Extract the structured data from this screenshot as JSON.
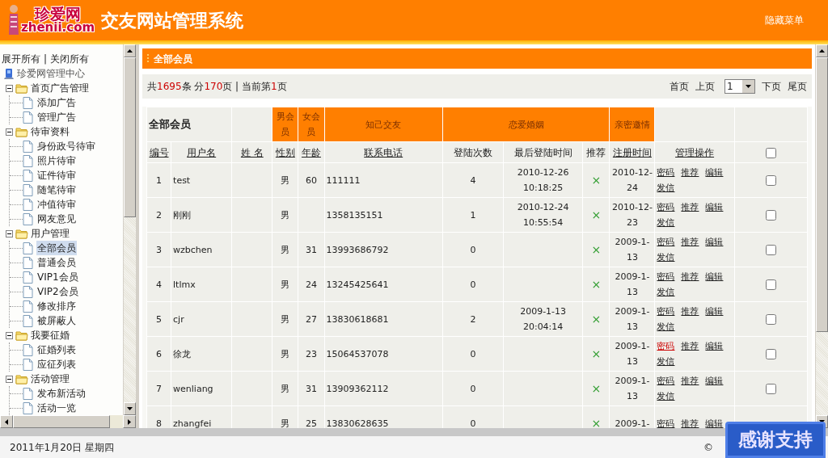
{
  "header": {
    "logo_text": "珍爱网",
    "logo_domain": "zhenii.com",
    "title": "交友网站管理系统",
    "hide_menu": "隐藏菜单"
  },
  "sidebar": {
    "expand_all": "展开所有",
    "separator": "|",
    "collapse_all": "关闭所有",
    "root": "珍爱网管理中心",
    "groups": [
      {
        "label": "首页广告管理",
        "expanded": true,
        "children": [
          {
            "label": "添加广告",
            "selected": false
          },
          {
            "label": "管理广告",
            "selected": false
          }
        ]
      },
      {
        "label": "待审资料",
        "expanded": true,
        "children": [
          {
            "label": "身份政号待审",
            "selected": false
          },
          {
            "label": "照片待审",
            "selected": false
          },
          {
            "label": "证件待审",
            "selected": false
          },
          {
            "label": "随笔待审",
            "selected": false
          },
          {
            "label": "冲值待审",
            "selected": false
          },
          {
            "label": "网友意见",
            "selected": false
          }
        ]
      },
      {
        "label": "用户管理",
        "expanded": true,
        "children": [
          {
            "label": "全部会员",
            "selected": true
          },
          {
            "label": "普通会员",
            "selected": false
          },
          {
            "label": "VIP1会员",
            "selected": false
          },
          {
            "label": "VIP2会员",
            "selected": false
          },
          {
            "label": "修改排序",
            "selected": false
          },
          {
            "label": "被屏蔽人",
            "selected": false
          }
        ]
      },
      {
        "label": "我要征婚",
        "expanded": true,
        "children": [
          {
            "label": "征婚列表",
            "selected": false
          },
          {
            "label": "应征列表",
            "selected": false
          }
        ]
      },
      {
        "label": "活动管理",
        "expanded": true,
        "children": [
          {
            "label": "发布新活动",
            "selected": false
          },
          {
            "label": "活动一览",
            "selected": false
          }
        ]
      }
    ]
  },
  "panel_title": "全部会员",
  "summary": [
    {
      "text": "共",
      "emphasis": false
    },
    {
      "text": "1695",
      "emphasis": true
    },
    {
      "text": "条 分",
      "emphasis": false
    },
    {
      "text": "170",
      "emphasis": true
    },
    {
      "text": "页 | 当前第",
      "emphasis": false
    },
    {
      "text": "1",
      "emphasis": true
    },
    {
      "text": "页",
      "emphasis": false
    }
  ],
  "pager": {
    "first": "首页",
    "prev": "上页",
    "page": "1",
    "next": "下页",
    "last": "尾页"
  },
  "table": {
    "caption": "全部会员",
    "groups": [
      {
        "label": "男会员",
        "kind": "orange"
      },
      {
        "label": "女会员",
        "kind": "orange"
      },
      {
        "label": "知己交友",
        "kind": "orange"
      },
      {
        "label": "恋爱婚姻",
        "kind": "orange"
      },
      {
        "label": "亲密邀情",
        "kind": "orange"
      }
    ],
    "columns": [
      {
        "label": "编号",
        "link": true
      },
      {
        "label": "用户名",
        "link": true
      },
      {
        "label": "姓 名",
        "link": true
      },
      {
        "label": "性别",
        "link": true
      },
      {
        "label": "年龄",
        "link": true
      },
      {
        "label": "联系电话",
        "link": true
      },
      {
        "label": "登陆次数",
        "link": false
      },
      {
        "label": "最后登陆时间",
        "link": false
      },
      {
        "label": "推荐",
        "link": false
      },
      {
        "label": "注册时间",
        "link": true
      },
      {
        "label": "管理操作",
        "link": true
      }
    ],
    "select_all": false,
    "rows": [
      {
        "id": "1",
        "username": "test",
        "gender": "男",
        "age": "60",
        "phone": "111111",
        "logins": "4",
        "last_login": "2010-12-26 10:18:25",
        "recommend": "×",
        "registered": "2010-12-24",
        "actions": [
          {
            "label": "密码",
            "highlighted": false
          },
          {
            "label": "推荐",
            "highlighted": false
          },
          {
            "label": "编辑",
            "highlighted": false
          },
          {
            "label": "发信",
            "highlighted": false
          }
        ],
        "checked": false
      },
      {
        "id": "2",
        "username": "刚刚",
        "gender": "男",
        "phone": "1358135151",
        "logins": "1",
        "last_login": "2010-12-24 10:55:54",
        "recommend": "×",
        "registered": "2010-12-23",
        "actions": [
          {
            "label": "密码",
            "highlighted": false
          },
          {
            "label": "推荐",
            "highlighted": false
          },
          {
            "label": "编辑",
            "highlighted": false
          },
          {
            "label": "发信",
            "highlighted": false
          }
        ],
        "checked": false
      },
      {
        "id": "3",
        "username": "wzbchen",
        "gender": "男",
        "age": "31",
        "phone": "13993686792",
        "logins": "0",
        "recommend": "×",
        "registered": "2009-1-13",
        "actions": [
          {
            "label": "密码",
            "highlighted": false
          },
          {
            "label": "推荐",
            "highlighted": false
          },
          {
            "label": "编辑",
            "highlighted": false
          },
          {
            "label": "发信",
            "highlighted": false
          }
        ],
        "checked": false
      },
      {
        "id": "4",
        "username": "ltlmx",
        "gender": "男",
        "age": "24",
        "phone": "13245425641",
        "logins": "0",
        "recommend": "×",
        "registered": "2009-1-13",
        "actions": [
          {
            "label": "密码",
            "highlighted": false
          },
          {
            "label": "推荐",
            "highlighted": false
          },
          {
            "label": "编辑",
            "highlighted": false
          },
          {
            "label": "发信",
            "highlighted": false
          }
        ],
        "checked": false
      },
      {
        "id": "5",
        "username": "cjr",
        "gender": "男",
        "age": "27",
        "phone": "13830618681",
        "logins": "2",
        "last_login": "2009-1-13 20:04:14",
        "recommend": "×",
        "registered": "2009-1-13",
        "actions": [
          {
            "label": "密码",
            "highlighted": false
          },
          {
            "label": "推荐",
            "highlighted": false
          },
          {
            "label": "编辑",
            "highlighted": false
          },
          {
            "label": "发信",
            "highlighted": false
          }
        ],
        "checked": false
      },
      {
        "id": "6",
        "username": "徐龙",
        "gender": "男",
        "age": "23",
        "phone": "15064537078",
        "logins": "0",
        "recommend": "×",
        "registered": "2009-1-13",
        "actions": [
          {
            "label": "密码",
            "highlighted": true
          },
          {
            "label": "推荐",
            "highlighted": false
          },
          {
            "label": "编辑",
            "highlighted": false
          },
          {
            "label": "发信",
            "highlighted": false
          }
        ],
        "checked": false
      },
      {
        "id": "7",
        "username": "wenliang",
        "gender": "男",
        "age": "31",
        "phone": "13909362112",
        "logins": "0",
        "recommend": "×",
        "registered": "2009-1-13",
        "actions": [
          {
            "label": "密码",
            "highlighted": false
          },
          {
            "label": "推荐",
            "highlighted": false
          },
          {
            "label": "编辑",
            "highlighted": false
          },
          {
            "label": "发信",
            "highlighted": false
          }
        ],
        "checked": false
      },
      {
        "id": "8",
        "username": "zhangfei",
        "gender": "男",
        "age": "25",
        "phone": "13830628635",
        "logins": "0",
        "recommend": "×",
        "registered": "2009-1-",
        "actions": [
          {
            "label": "密码",
            "highlighted": false
          },
          {
            "label": "推荐",
            "highlighted": false
          },
          {
            "label": "编辑",
            "highlighted": false
          }
        ]
      }
    ]
  },
  "footer": {
    "date": "2011年1月20日 星期四",
    "copyright": "©"
  },
  "support_badge": "感谢支持"
}
